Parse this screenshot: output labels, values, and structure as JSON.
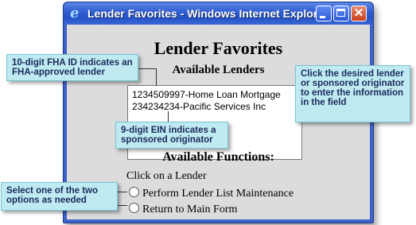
{
  "window": {
    "title": "Lender Favorites - Windows Internet Explorer",
    "icons": {
      "app": "ie-icon",
      "minimize": "minimize-icon",
      "maximize": "maximize-icon",
      "close": "close-icon"
    },
    "close_glyph": "✕",
    "app_glyph": "e"
  },
  "page": {
    "title": "Lender Favorites",
    "available_lenders_heading": "Available Lenders",
    "lenders": [
      "1234509997-Home Loan Mortgage",
      "234234234-Pacific Services Inc"
    ],
    "available_functions_heading": "Available Functions:",
    "hint": "Click on a Lender",
    "options": [
      "Perform Lender List Maintenance",
      "Return to Main Form"
    ]
  },
  "callouts": {
    "fha": "10-digit FHA ID indicates an FHA-approved lender",
    "click": "Click the desired lender or sponsored originator to enter the information in the field",
    "ein": "9-digit EIN indicates a sponsored originator",
    "select": "Select one of the two options as needed"
  },
  "colors": {
    "titlebar": "#2f5cd0",
    "client_bg": "#dcdcdc",
    "callout_bg": "#bfeaf2",
    "callout_text": "#1a2a5a"
  }
}
